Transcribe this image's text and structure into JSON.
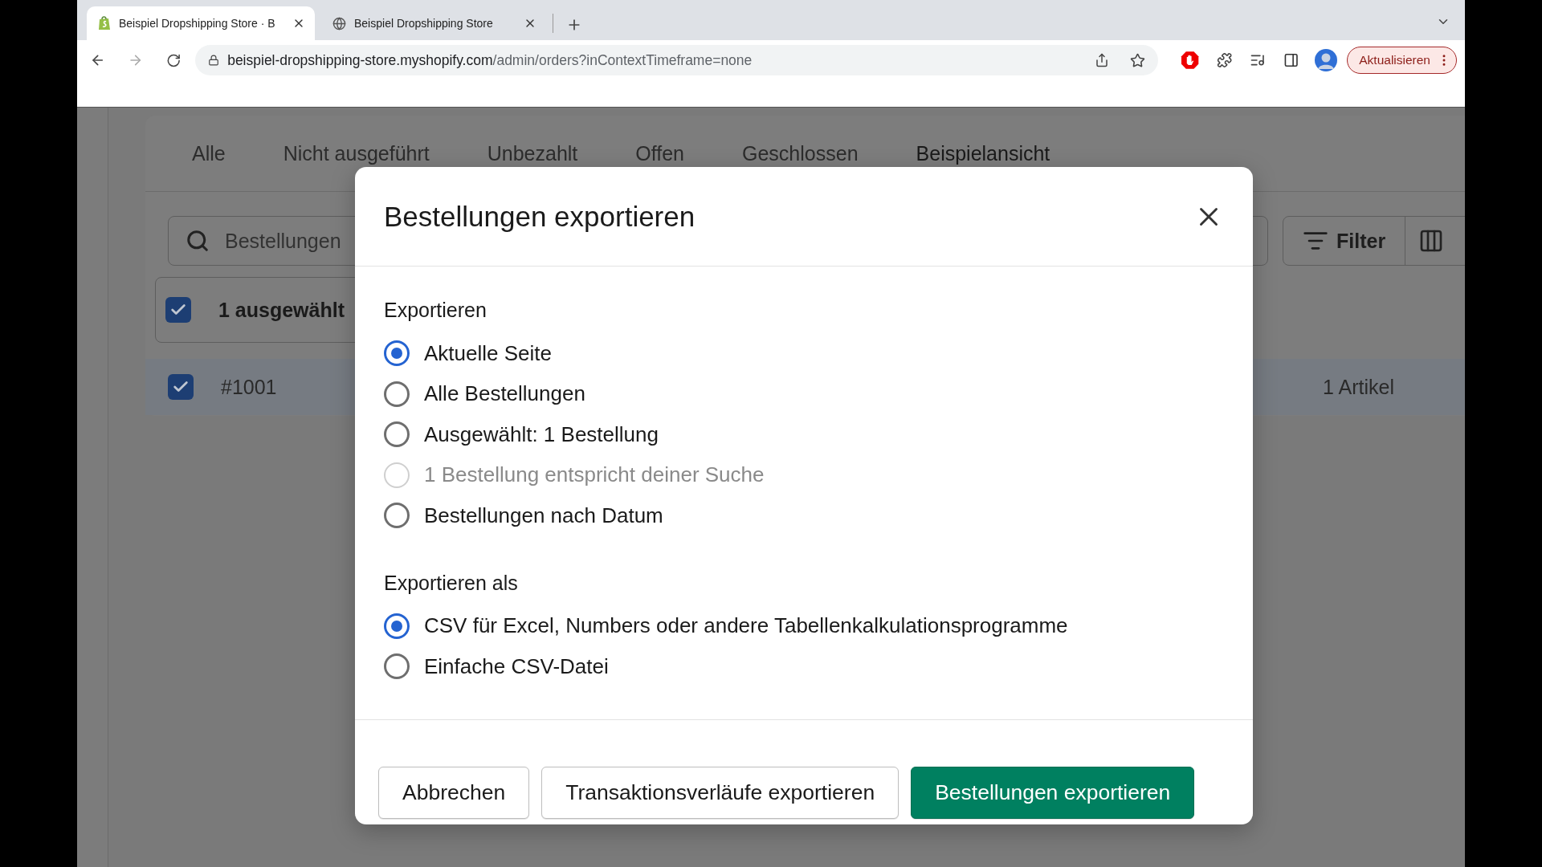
{
  "browser": {
    "tabs": [
      {
        "title": "Beispiel Dropshipping Store · B",
        "kind": "shop",
        "selected": true
      },
      {
        "title": "Beispiel Dropshipping Store",
        "kind": "globe",
        "selected": false
      }
    ],
    "address": {
      "host": "beispiel-dropshipping-store.myshopify.com",
      "path": "/admin/orders?inContextTimeframe=none"
    },
    "update_button": "Aktualisieren"
  },
  "page": {
    "tabs": [
      {
        "label": "Alle",
        "selected": false
      },
      {
        "label": "Nicht ausgeführt",
        "selected": false
      },
      {
        "label": "Unbezahlt",
        "selected": false
      },
      {
        "label": "Offen",
        "selected": false
      },
      {
        "label": "Geschlossen",
        "selected": false
      },
      {
        "label": "Beispielansicht",
        "selected": true
      }
    ],
    "search": {
      "placeholder": "Bestellungen"
    },
    "filter_button": "Filter",
    "selection": {
      "label": "1 ausgewählt",
      "checked": true
    },
    "rows": [
      {
        "order": "#1001",
        "items": "1 Artikel",
        "checked": true
      }
    ]
  },
  "dialog": {
    "title": "Bestellungen exportieren",
    "sections": [
      {
        "heading": "Exportieren",
        "options": [
          {
            "label": "Aktuelle Seite",
            "selected": true,
            "disabled": false
          },
          {
            "label": "Alle Bestellungen",
            "selected": false,
            "disabled": false
          },
          {
            "label": "Ausgewählt: 1 Bestellung",
            "selected": false,
            "disabled": false
          },
          {
            "label": "1 Bestellung entspricht deiner Suche",
            "selected": false,
            "disabled": true
          },
          {
            "label": "Bestellungen nach Datum",
            "selected": false,
            "disabled": false
          }
        ]
      },
      {
        "heading": "Exportieren als",
        "options": [
          {
            "label": "CSV für Excel, Numbers oder andere Tabellenkalkulationsprogramme",
            "selected": true,
            "disabled": false
          },
          {
            "label": "Einfache CSV-Datei",
            "selected": false,
            "disabled": false
          }
        ]
      }
    ],
    "buttons": [
      {
        "label": "Abbrechen",
        "kind": "secondary"
      },
      {
        "label": "Transaktionsverläufe exportieren",
        "kind": "secondary"
      },
      {
        "label": "Bestellungen exportieren",
        "kind": "primary"
      }
    ]
  }
}
